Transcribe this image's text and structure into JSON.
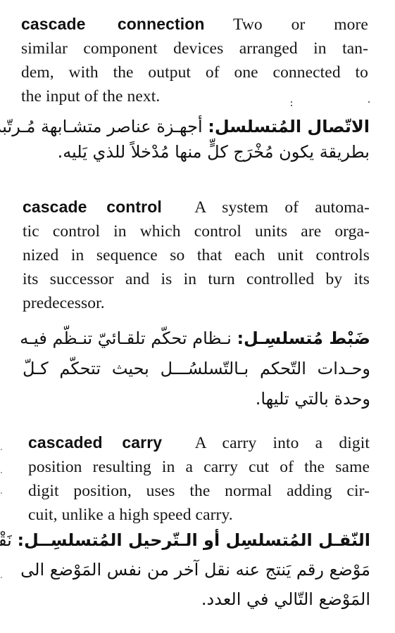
{
  "page": {
    "type": "bilingual technical dictionary page",
    "entries": [
      {
        "term": "cascade connection",
        "definition_en_lines": [
          "Two or more",
          "similar component devices arranged in tan-",
          "dem, with the output of one connected to",
          "the input of the next."
        ],
        "term_ar": "الاتّصال المُتسلسل:",
        "definition_ar_lines": [
          "أجهـزة عناصر متشـابهة مُـرتّبة",
          "بطريقة يكون مُخْرَج كلٍّ منها مُدْخلاً للذي يَليه."
        ]
      },
      {
        "term": "cascade control",
        "definition_en_lines": [
          "A system of automa-",
          "tic control in which control units are orga-",
          "nized in sequence so that each unit controls",
          "its successor and is in turn controlled by its",
          "predecessor."
        ],
        "term_ar": "ضَبْط مُتسلسِـل:",
        "definition_ar_lines": [
          "نـظام تحكّم تلقـائيّ تنـظّم فيـه",
          "وحـدات التّحكم بـالتّسلسُـــل بحيث تتحكّم كـلّ",
          "وحدة بالتي تليها."
        ]
      },
      {
        "term": "cascaded carry",
        "definition_en_lines": [
          "A carry into a digit",
          "position resulting in a carry cut of the same",
          "digit position, uses the normal adding cir-",
          "cuit, unlike a high speed carry."
        ],
        "term_ar": "النّقـل المُتسلسِل أو الـتّرحيل المُتسلسِــل:",
        "definition_ar_lines": [
          "نَقْـل إلى",
          "مَوْضع رقم يَنتج عنه نقل آخر من نفس المَوْضع الى",
          "المَوْضع التّالي في العدد."
        ]
      }
    ]
  }
}
